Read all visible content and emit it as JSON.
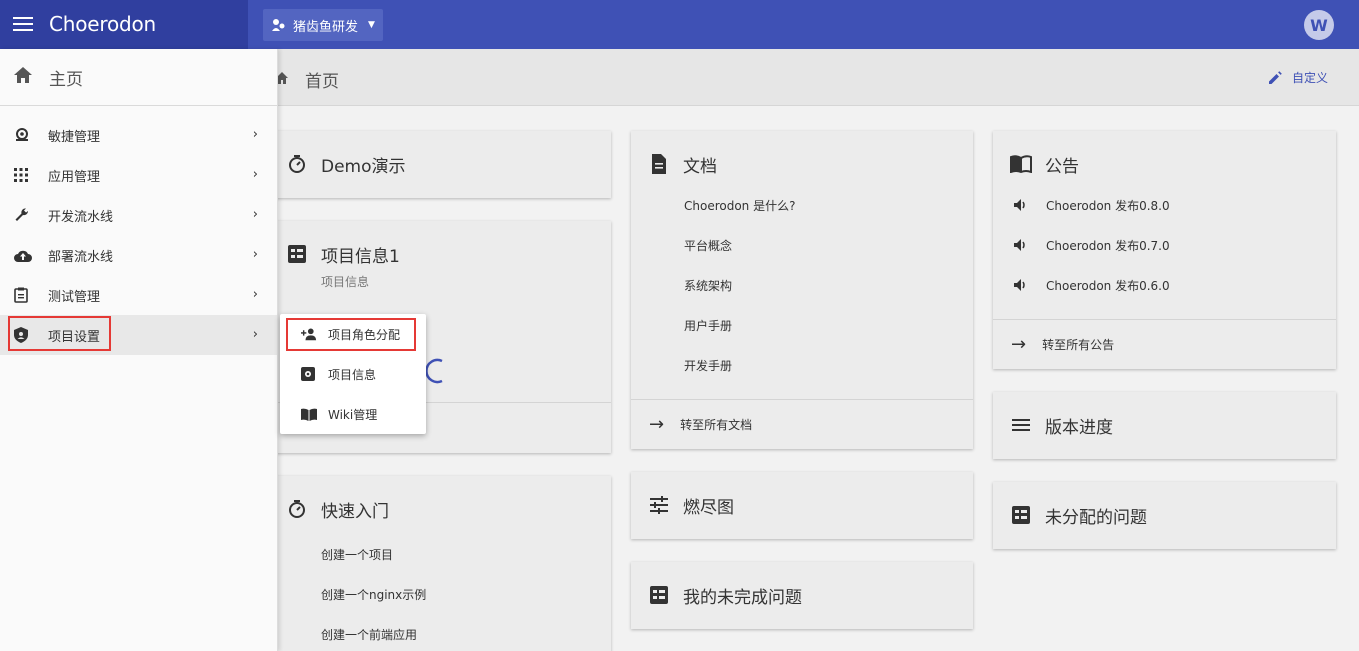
{
  "header": {
    "brand": "Choerodon",
    "project": "猪齿鱼研发",
    "avatar_letter": "W"
  },
  "subheader": {
    "title": "首页",
    "customize": "自定义"
  },
  "sidebar": {
    "home": "主页",
    "items": [
      {
        "label": "敏捷管理",
        "icon": "agile-icon"
      },
      {
        "label": "应用管理",
        "icon": "apps-icon"
      },
      {
        "label": "开发流水线",
        "icon": "wrench-icon"
      },
      {
        "label": "部署流水线",
        "icon": "cloud-upload-icon"
      },
      {
        "label": "测试管理",
        "icon": "clipboard-icon"
      },
      {
        "label": "项目设置",
        "icon": "shield-icon"
      }
    ]
  },
  "popup": {
    "items": [
      {
        "label": "项目角色分配",
        "icon": "person-add-icon"
      },
      {
        "label": "项目信息",
        "icon": "settings-box-icon"
      },
      {
        "label": "Wiki管理",
        "icon": "book-icon"
      }
    ]
  },
  "cards": {
    "demo": {
      "title": "Demo演示"
    },
    "project_info": {
      "title": "项目信息1",
      "sub": "项目信息"
    },
    "quick_start": {
      "title": "快速入门",
      "items": [
        "创建一个项目",
        "创建一个nginx示例",
        "创建一个前端应用"
      ]
    },
    "docs": {
      "title": "文档",
      "items": [
        "Choerodon 是什么?",
        "平台概念",
        "系统架构",
        "用户手册",
        "开发手册"
      ],
      "footer": "转至所有文档"
    },
    "burndown": {
      "title": "燃尽图"
    },
    "my_issues": {
      "title": "我的未完成问题"
    },
    "notice": {
      "title": "公告",
      "items": [
        "Choerodon 发布0.8.0",
        "Choerodon 发布0.7.0",
        "Choerodon 发布0.6.0"
      ],
      "footer": "转至所有公告"
    },
    "version": {
      "title": "版本进度"
    },
    "unassigned": {
      "title": "未分配的问题"
    }
  }
}
